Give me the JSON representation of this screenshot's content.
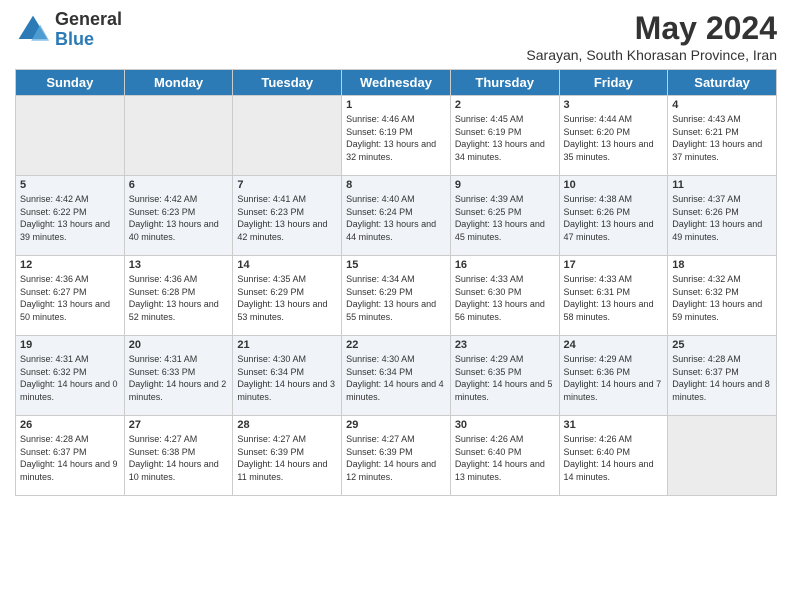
{
  "header": {
    "logo_general": "General",
    "logo_blue": "Blue",
    "month_year": "May 2024",
    "location": "Sarayan, South Khorasan Province, Iran"
  },
  "days_of_week": [
    "Sunday",
    "Monday",
    "Tuesday",
    "Wednesday",
    "Thursday",
    "Friday",
    "Saturday"
  ],
  "weeks": [
    [
      {
        "day": "",
        "empty": true
      },
      {
        "day": "",
        "empty": true
      },
      {
        "day": "",
        "empty": true
      },
      {
        "day": "1",
        "sunrise": "4:46 AM",
        "sunset": "6:19 PM",
        "daylight": "13 hours and 32 minutes."
      },
      {
        "day": "2",
        "sunrise": "4:45 AM",
        "sunset": "6:19 PM",
        "daylight": "13 hours and 34 minutes."
      },
      {
        "day": "3",
        "sunrise": "4:44 AM",
        "sunset": "6:20 PM",
        "daylight": "13 hours and 35 minutes."
      },
      {
        "day": "4",
        "sunrise": "4:43 AM",
        "sunset": "6:21 PM",
        "daylight": "13 hours and 37 minutes."
      }
    ],
    [
      {
        "day": "5",
        "sunrise": "4:42 AM",
        "sunset": "6:22 PM",
        "daylight": "13 hours and 39 minutes."
      },
      {
        "day": "6",
        "sunrise": "4:42 AM",
        "sunset": "6:23 PM",
        "daylight": "13 hours and 40 minutes."
      },
      {
        "day": "7",
        "sunrise": "4:41 AM",
        "sunset": "6:23 PM",
        "daylight": "13 hours and 42 minutes."
      },
      {
        "day": "8",
        "sunrise": "4:40 AM",
        "sunset": "6:24 PM",
        "daylight": "13 hours and 44 minutes."
      },
      {
        "day": "9",
        "sunrise": "4:39 AM",
        "sunset": "6:25 PM",
        "daylight": "13 hours and 45 minutes."
      },
      {
        "day": "10",
        "sunrise": "4:38 AM",
        "sunset": "6:26 PM",
        "daylight": "13 hours and 47 minutes."
      },
      {
        "day": "11",
        "sunrise": "4:37 AM",
        "sunset": "6:26 PM",
        "daylight": "13 hours and 49 minutes."
      }
    ],
    [
      {
        "day": "12",
        "sunrise": "4:36 AM",
        "sunset": "6:27 PM",
        "daylight": "13 hours and 50 minutes."
      },
      {
        "day": "13",
        "sunrise": "4:36 AM",
        "sunset": "6:28 PM",
        "daylight": "13 hours and 52 minutes."
      },
      {
        "day": "14",
        "sunrise": "4:35 AM",
        "sunset": "6:29 PM",
        "daylight": "13 hours and 53 minutes."
      },
      {
        "day": "15",
        "sunrise": "4:34 AM",
        "sunset": "6:29 PM",
        "daylight": "13 hours and 55 minutes."
      },
      {
        "day": "16",
        "sunrise": "4:33 AM",
        "sunset": "6:30 PM",
        "daylight": "13 hours and 56 minutes."
      },
      {
        "day": "17",
        "sunrise": "4:33 AM",
        "sunset": "6:31 PM",
        "daylight": "13 hours and 58 minutes."
      },
      {
        "day": "18",
        "sunrise": "4:32 AM",
        "sunset": "6:32 PM",
        "daylight": "13 hours and 59 minutes."
      }
    ],
    [
      {
        "day": "19",
        "sunrise": "4:31 AM",
        "sunset": "6:32 PM",
        "daylight": "14 hours and 0 minutes."
      },
      {
        "day": "20",
        "sunrise": "4:31 AM",
        "sunset": "6:33 PM",
        "daylight": "14 hours and 2 minutes."
      },
      {
        "day": "21",
        "sunrise": "4:30 AM",
        "sunset": "6:34 PM",
        "daylight": "14 hours and 3 minutes."
      },
      {
        "day": "22",
        "sunrise": "4:30 AM",
        "sunset": "6:34 PM",
        "daylight": "14 hours and 4 minutes."
      },
      {
        "day": "23",
        "sunrise": "4:29 AM",
        "sunset": "6:35 PM",
        "daylight": "14 hours and 5 minutes."
      },
      {
        "day": "24",
        "sunrise": "4:29 AM",
        "sunset": "6:36 PM",
        "daylight": "14 hours and 7 minutes."
      },
      {
        "day": "25",
        "sunrise": "4:28 AM",
        "sunset": "6:37 PM",
        "daylight": "14 hours and 8 minutes."
      }
    ],
    [
      {
        "day": "26",
        "sunrise": "4:28 AM",
        "sunset": "6:37 PM",
        "daylight": "14 hours and 9 minutes."
      },
      {
        "day": "27",
        "sunrise": "4:27 AM",
        "sunset": "6:38 PM",
        "daylight": "14 hours and 10 minutes."
      },
      {
        "day": "28",
        "sunrise": "4:27 AM",
        "sunset": "6:39 PM",
        "daylight": "14 hours and 11 minutes."
      },
      {
        "day": "29",
        "sunrise": "4:27 AM",
        "sunset": "6:39 PM",
        "daylight": "14 hours and 12 minutes."
      },
      {
        "day": "30",
        "sunrise": "4:26 AM",
        "sunset": "6:40 PM",
        "daylight": "14 hours and 13 minutes."
      },
      {
        "day": "31",
        "sunrise": "4:26 AM",
        "sunset": "6:40 PM",
        "daylight": "14 hours and 14 minutes."
      },
      {
        "day": "",
        "empty": true
      }
    ]
  ]
}
